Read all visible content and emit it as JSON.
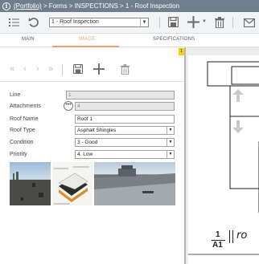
{
  "titlebar": {
    "info_icon": "i",
    "portfolio_link": "(Portfolio)",
    "path": " > Forms > INSPECTIONS > 1 - Roof Inspection"
  },
  "toolbar": {
    "record_value": "1 - Roof Inspection",
    "icons": [
      "list-icon",
      "refresh-icon",
      "save-icon",
      "add-icon",
      "trash-icon",
      "mail-icon"
    ]
  },
  "tabs": [
    {
      "label": "MAIN"
    },
    {
      "label": "IMAGE"
    },
    {
      "label": "SPECIFICATIONS"
    }
  ],
  "active_tab": "IMAGE",
  "accent_color": "#f0a070",
  "form": {
    "line": {
      "label": "Line",
      "value": "1"
    },
    "attachments": {
      "label": "Attachments",
      "value": "4"
    },
    "roof_name": {
      "label": "Roof Name",
      "value": "Roof 1"
    },
    "roof_type": {
      "label": "Roof Type",
      "value": "Asphalt Shingles"
    },
    "condition": {
      "label": "Condition",
      "value": "3 - Good"
    },
    "priority": {
      "label": "Priority",
      "value": "4. Low"
    }
  },
  "panel_marker": "1",
  "drawing": {
    "ref_number": "1",
    "ref_sheet": "A1",
    "partial_title": "ro"
  }
}
